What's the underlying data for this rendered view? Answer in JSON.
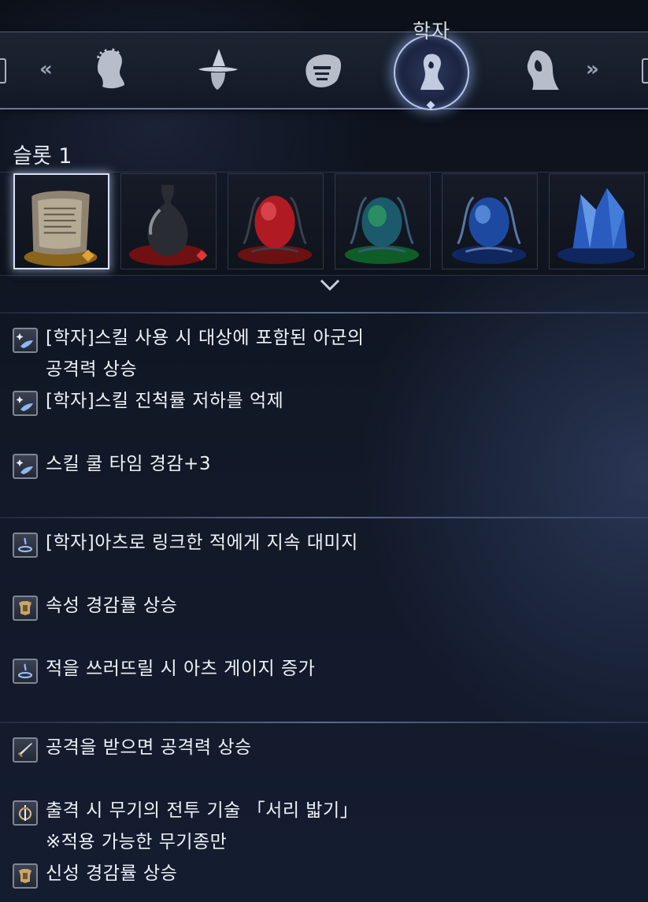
{
  "header": {
    "selected_class": "학자",
    "prev_chevron": "«",
    "next_chevron": "»",
    "class_icons": [
      "laurel-figure-icon",
      "witch-hat-figure-icon",
      "masked-figure-icon",
      "scholar-figure-icon",
      "hooded-figure-icon"
    ],
    "selected_index": 3
  },
  "slot": {
    "label": "슬롯 1",
    "relics": [
      {
        "icon": "scroll-relic-icon",
        "selected": true,
        "badge_color": "#e0a23a"
      },
      {
        "icon": "vase-relic-icon",
        "selected": false,
        "badge_color": "#e0383a"
      },
      {
        "icon": "red-egg-relic-icon",
        "selected": false
      },
      {
        "icon": "green-egg-relic-icon",
        "selected": false
      },
      {
        "icon": "blue-egg-relic-icon",
        "selected": false
      },
      {
        "icon": "blue-crystal-relic-icon",
        "selected": false
      }
    ]
  },
  "effects": {
    "group1": [
      {
        "icon": "skill-sparkle-icon",
        "line1": "[학자]스킬 사용 시 대상에 포함된 아군의",
        "line2": "공격력 상승"
      },
      {
        "icon": "skill-sparkle-icon",
        "line1": "[학자]스킬 진척률 저하를 억제"
      },
      {
        "icon": "skill-sparkle-icon",
        "line1": "스킬 쿨 타임 경감+3"
      }
    ],
    "group2": [
      {
        "icon": "arts-gauge-icon",
        "line1": "[학자]아츠로 링크한 적에게 지속 대미지"
      },
      {
        "icon": "armor-icon",
        "line1": "속성 경감률 상승"
      },
      {
        "icon": "arts-gauge-icon",
        "line1": "적을 쓰러뜨릴 시 아츠 게이지 증가"
      }
    ],
    "group3": [
      {
        "icon": "sword-icon",
        "line1": "공격을 받으면 공격력 상승"
      },
      {
        "icon": "weapon-skill-icon",
        "line1": "출격 시 무기의 전투 기술 「서리 밟기」",
        "line2": "※적용 가능한 무기종만"
      },
      {
        "icon": "armor-icon",
        "line1": "신성 경감률 상승"
      }
    ]
  },
  "colors": {
    "accent": "#b9c8ec",
    "text": "#eef1f7",
    "divider": "#7888ac"
  }
}
